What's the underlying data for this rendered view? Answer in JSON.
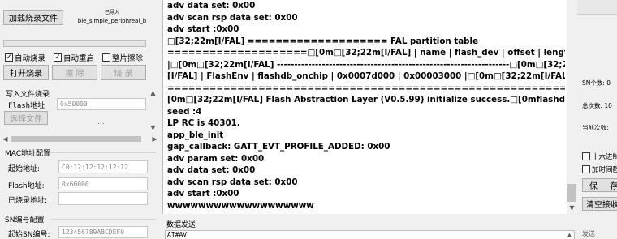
{
  "left_panel": {
    "load_burn_file_label": "加载烧录文件",
    "loaded_status": "已导入",
    "loaded_file": "ble_simple_periphreal_b",
    "checkboxes": [
      {
        "label": "自动烧录",
        "checked": true
      },
      {
        "label": "自动重启",
        "checked": true
      },
      {
        "label": "整片擦除",
        "checked": false
      }
    ],
    "open_firmware_label": "打开烧录",
    "erase_label": "擦  除",
    "burn_label": "烧  录",
    "write_file_title": "写入文件烧录",
    "flash_addr_label": "Flash地址",
    "flash_addr_value": "0x50000",
    "select_file_label": "选择文件",
    "ellipsis": "...",
    "mac_title": "MAC地址配置",
    "start_addr_label": "起始地址:",
    "start_addr_value": "C0:12:12:12:12:12",
    "flash_addr2_label": "Flash地址:",
    "flash_addr2_value": "0x60000",
    "burned_addr_label": "已烧录地址:",
    "burned_addr_value": "",
    "sn_title": "SN编号配置",
    "sn_start_label": "起始SN编号:",
    "sn_start_value": "123456789ABCDEF0"
  },
  "log": {
    "lines": [
      "adv data set: 0x00",
      "adv scan rsp data set: 0x00",
      "adv start :0x00",
      "□[32;22m[I/FAL] ==================== FAL partition table",
      "====================□[0m□[32;22m[I/FAL] | name     | flash_dev    |   offset   |    length",
      "|□[0m□[32;22m[I/FAL] -------------------------------------------------------------------□[0m□[32;22m",
      "[I/FAL] | FlashEnv | flashdb_onchip | 0x0007d000 | 0x00003000 |□[0m□[32;22m[I/FAL]",
      "=============================================================================□",
      "[0m□[32;22m[I/FAL] Flash Abstraction Layer (V0.5.99) initialize success.□[0mflashdb get random",
      "seed :4",
      "LP RC is 40301.",
      "app_ble_init",
      "gap_callback: GATT_EVT_PROFILE_ADDED: 0x00",
      "adv param set: 0x00",
      "adv data set: 0x00",
      "adv scan rsp data set: 0x00",
      "adv start :0x00",
      "wwwwwwwwwwwwwwwwwww"
    ]
  },
  "send": {
    "title": "数据发送",
    "value": "AT#AV",
    "send_button_partial": "发送"
  },
  "right_panel": {
    "sn_count_label": "SN个数: 0",
    "total_count_label": "总次数: 10",
    "current_count_label": "当前次数:",
    "hex_display_label": "十六进制",
    "timestamp_label": "加时间戳",
    "save_label": "保 存",
    "clear_recv_label": "清空接收"
  }
}
